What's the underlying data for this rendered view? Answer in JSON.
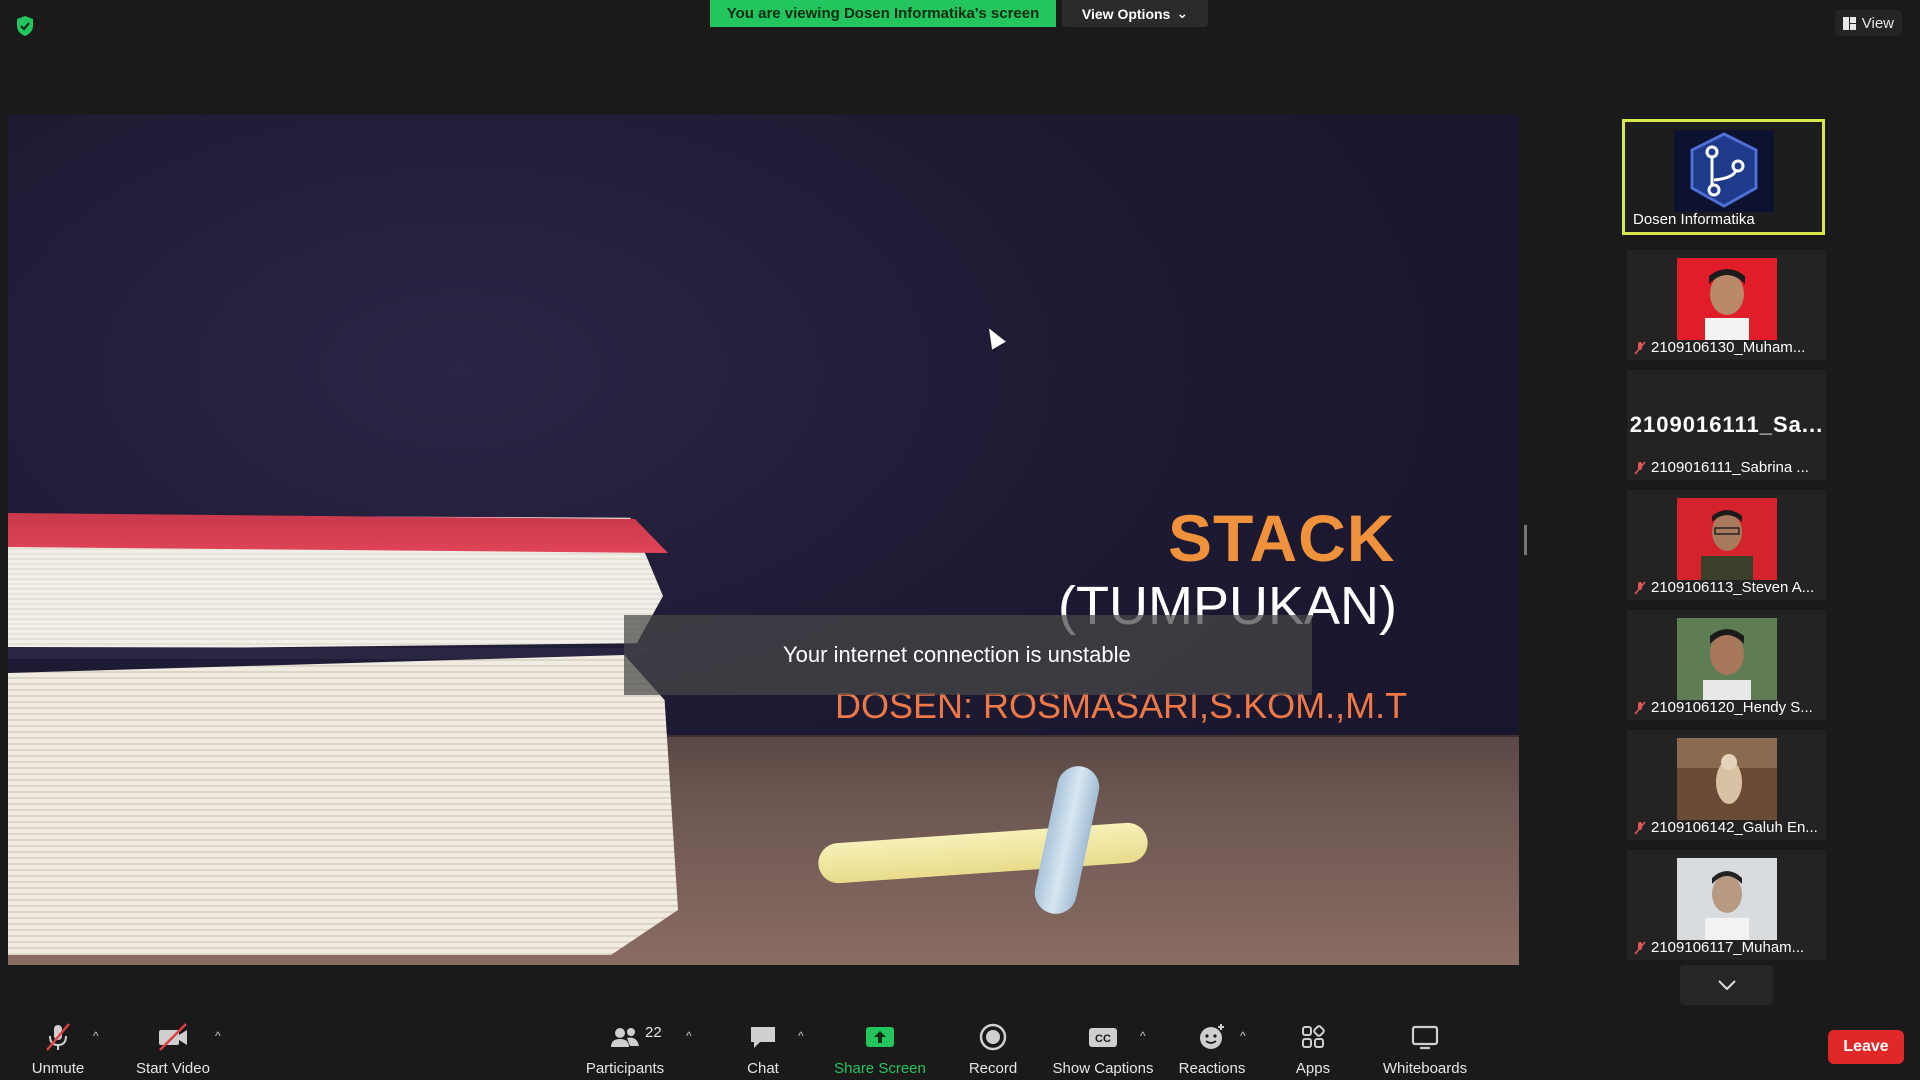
{
  "top": {
    "viewing_banner": "You are viewing Dosen Informatika's screen",
    "view_options": "View Options",
    "view": "View"
  },
  "slide": {
    "title": "STACK",
    "subtitle": "(TUMPUKAN)",
    "dosen": "DOSEN: ROSMASARI,S.KOM.,M.T",
    "notice": "Your internet connection is unstable"
  },
  "participants": {
    "active": "Dosen Informatika",
    "list": [
      {
        "name": "2109106130_Muham..."
      },
      {
        "name": "2109016111_Sabrina ...",
        "display": "2109016111_Sa..."
      },
      {
        "name": "2109106113_Steven A..."
      },
      {
        "name": "2109106120_Hendy S..."
      },
      {
        "name": "2109106142_Galuh En..."
      },
      {
        "name": "2109106117_Muham..."
      }
    ]
  },
  "toolbar": {
    "unmute": "Unmute",
    "start_video": "Start Video",
    "participants": "Participants",
    "participants_count": "22",
    "chat": "Chat",
    "share_screen": "Share Screen",
    "record": "Record",
    "show_captions": "Show Captions",
    "reactions": "Reactions",
    "apps": "Apps",
    "whiteboards": "Whiteboards",
    "leave": "Leave"
  },
  "colors": {
    "green": "#22c55e",
    "leave_red": "#e02828",
    "active_border": "#d6e84a",
    "slide_orange": "#f0923b"
  }
}
